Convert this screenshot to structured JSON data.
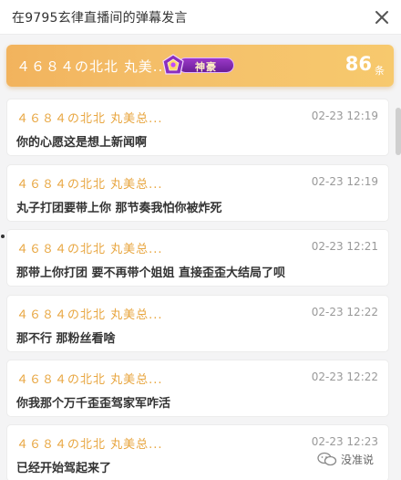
{
  "window": {
    "title": "在9795玄律直播间的弹幕发言"
  },
  "summary": {
    "user_name": "４６８４の北北 丸美...",
    "badge_label": "神豪",
    "count": "86",
    "count_unit": "条"
  },
  "messages": [
    {
      "user": "４６８４の北北 丸美总...",
      "time": "02-23 12:19",
      "text": "你的心愿这是想上新闻啊"
    },
    {
      "user": "４６８４の北北 丸美总...",
      "time": "02-23 12:19",
      "text": "丸子打团要带上你 那节奏我怕你被炸死"
    },
    {
      "user": "４６８４の北北 丸美总...",
      "time": "02-23 12:21",
      "text": "那带上你打团 要不再带个姐姐 直接歪歪大结局了呗"
    },
    {
      "user": "４６８４の北北 丸美总...",
      "time": "02-23 12:22",
      "text": "那不行 那粉丝看啥"
    },
    {
      "user": "４６８４の北北 丸美总...",
      "time": "02-23 12:22",
      "text": "你我那个万千歪歪驾家军咋活"
    },
    {
      "user": "４６８４の北北 丸美总...",
      "time": "02-23 12:23",
      "text": "已经开始驾起来了"
    }
  ],
  "watermark": {
    "text": "没准说"
  },
  "colors": {
    "accent_orange": "#f4c06a",
    "username_color": "#e8a640",
    "badge_purple": "#7a25a8"
  },
  "icons": {
    "close": "close-icon",
    "badge": "gem-badge-icon",
    "watermark": "wechat-icon"
  }
}
